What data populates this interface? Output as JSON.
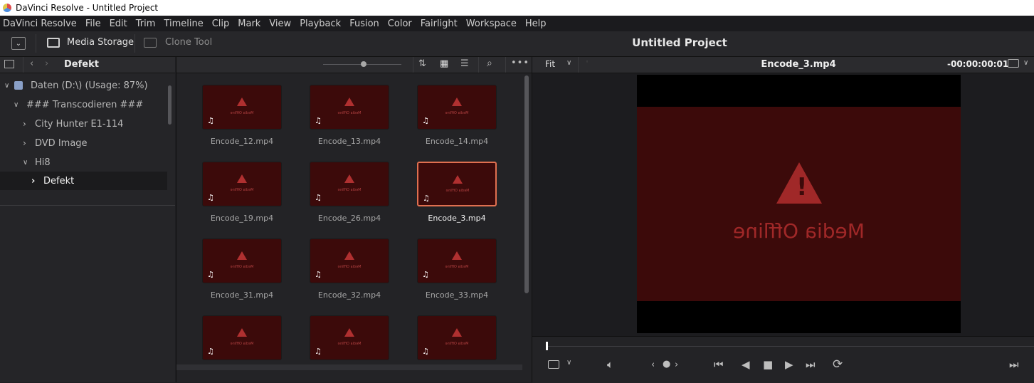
{
  "window": {
    "title": "DaVinci Resolve - Untitled Project"
  },
  "menu": [
    "DaVinci Resolve",
    "File",
    "Edit",
    "Trim",
    "Timeline",
    "Clip",
    "Mark",
    "View",
    "Playback",
    "Fusion",
    "Color",
    "Fairlight",
    "Workspace",
    "Help"
  ],
  "toolbar": {
    "media_storage": "Media Storage",
    "clone_tool": "Clone Tool",
    "project_title": "Untitled Project"
  },
  "browser": {
    "current_folder": "Defekt",
    "tree": [
      {
        "label": "Daten (D:\\) (Usage: 87%)",
        "indent": 0,
        "expanded": true
      },
      {
        "label": "### Transcodieren ###",
        "indent": 1,
        "expanded": true
      },
      {
        "label": "City Hunter E1-114",
        "indent": 2,
        "expanded": false
      },
      {
        "label": "DVD Image",
        "indent": 2,
        "expanded": false
      },
      {
        "label": "Hi8",
        "indent": 2,
        "expanded": true
      },
      {
        "label": "Defekt",
        "indent": 3,
        "expanded": false,
        "selected": true
      }
    ],
    "clips": [
      {
        "name": "Encode_12.mp4"
      },
      {
        "name": "Encode_13.mp4"
      },
      {
        "name": "Encode_14.mp4"
      },
      {
        "name": "Encode_19.mp4"
      },
      {
        "name": "Encode_26.mp4"
      },
      {
        "name": "Encode_3.mp4",
        "selected": true
      },
      {
        "name": "Encode_31.mp4"
      },
      {
        "name": "Encode_32.mp4"
      },
      {
        "name": "Encode_33.mp4"
      },
      {
        "name": ""
      },
      {
        "name": ""
      },
      {
        "name": ""
      }
    ]
  },
  "viewer": {
    "zoom": "Fit",
    "clip_name": "Encode_3.mp4",
    "timecode": "-00:00:00:01",
    "offline_label": "Media Offline"
  },
  "colors": {
    "accent_selected": "#e07050",
    "offline_bg": "#3c0a0a",
    "warning": "#a02828"
  }
}
